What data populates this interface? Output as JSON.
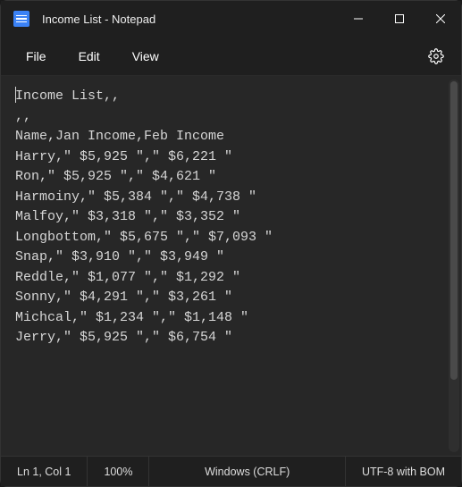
{
  "titlebar": {
    "title": "Income List - Notepad"
  },
  "menu": {
    "file": "File",
    "edit": "Edit",
    "view": "View"
  },
  "content": "Income List,,\n,,\nName,Jan Income,Feb Income\nHarry,\" $5,925 \",\" $6,221 \"\nRon,\" $5,925 \",\" $4,621 \"\nHarmoiny,\" $5,384 \",\" $4,738 \"\nMalfoy,\" $3,318 \",\" $3,352 \"\nLongbottom,\" $5,675 \",\" $7,093 \"\nSnap,\" $3,910 \",\" $3,949 \"\nReddle,\" $1,077 \",\" $1,292 \"\nSonny,\" $4,291 \",\" $3,261 \"\nMichcal,\" $1,234 \",\" $1,148 \"\nJerry,\" $5,925 \",\" $6,754 \"\n",
  "statusbar": {
    "position": "Ln 1, Col 1",
    "zoom": "100%",
    "line_ending": "Windows (CRLF)",
    "encoding": "UTF-8 with BOM"
  }
}
